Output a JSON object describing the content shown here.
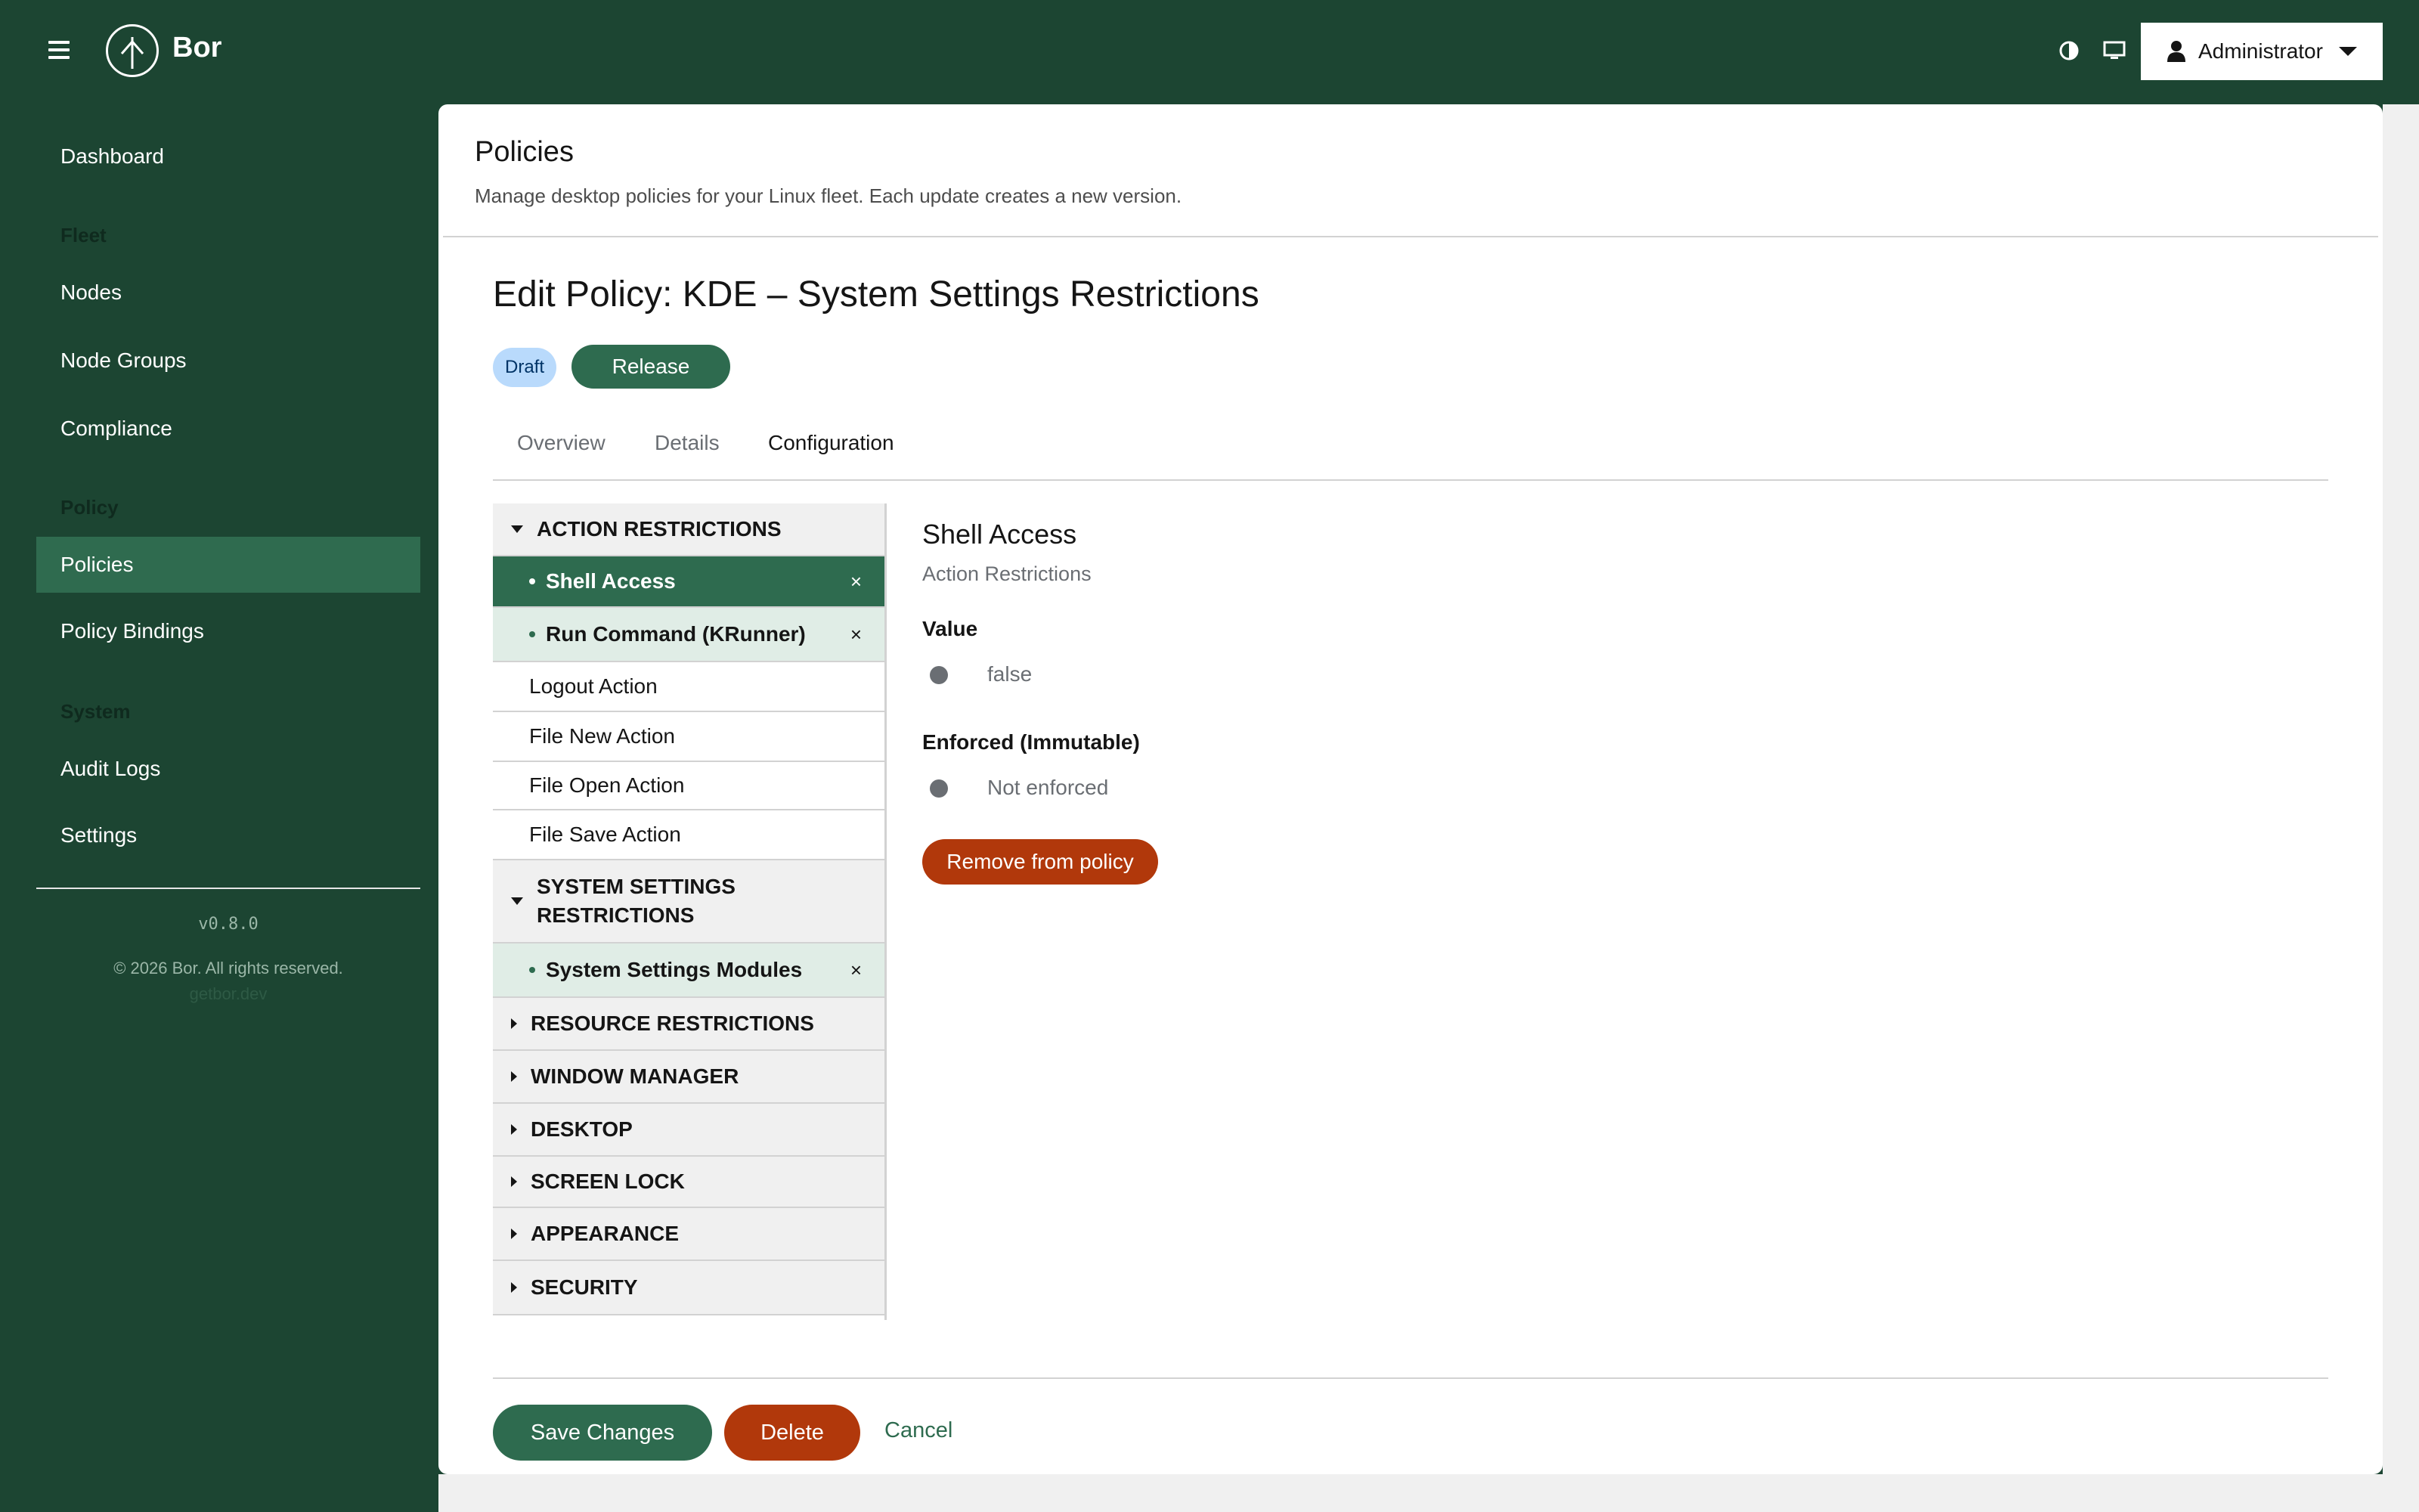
{
  "app": {
    "name": "Bor"
  },
  "header": {
    "user_label": "Administrator"
  },
  "sidebar": {
    "dashboard": "Dashboard",
    "fleet_heading": "Fleet",
    "nodes": "Nodes",
    "node_groups": "Node Groups",
    "compliance": "Compliance",
    "policy_heading": "Policy",
    "policies": "Policies",
    "policy_bindings": "Policy Bindings",
    "system_heading": "System",
    "audit_logs": "Audit Logs",
    "settings": "Settings",
    "version": "v0.8.0",
    "copyright": "© 2026 Bor. All rights reserved.",
    "site": "getbor.dev"
  },
  "page": {
    "title": "Policies",
    "subtitle": "Manage desktop policies for your Linux fleet. Each update creates a new version.",
    "edit_title": "Edit Policy: KDE – System Settings Restrictions",
    "status_badge": "Draft",
    "release_button": "Release"
  },
  "tabs": {
    "overview": "Overview",
    "details": "Details",
    "configuration": "Configuration"
  },
  "tree": {
    "action_restrictions": "ACTION RESTRICTIONS",
    "shell_access": "Shell Access",
    "run_command": "Run Command (KRunner)",
    "logout_action": "Logout Action",
    "file_new_action": "File New Action",
    "file_open_action": "File Open Action",
    "file_save_action": "File Save Action",
    "system_settings_restrictions_1": "SYSTEM SETTINGS",
    "system_settings_restrictions_2": "RESTRICTIONS",
    "system_settings_modules": "System Settings Modules",
    "resource_restrictions": "RESOURCE RESTRICTIONS",
    "window_manager": "WINDOW MANAGER",
    "desktop": "DESKTOP",
    "screen_lock": "SCREEN LOCK",
    "appearance": "APPEARANCE",
    "security": "SECURITY",
    "remove_glyph": "×"
  },
  "detail": {
    "title": "Shell Access",
    "category": "Action Restrictions",
    "value_label": "Value",
    "value": "false",
    "enforced_label": "Enforced (Immutable)",
    "enforced_value": "Not enforced",
    "remove_button": "Remove from policy"
  },
  "footer": {
    "save": "Save Changes",
    "delete": "Delete",
    "cancel": "Cancel"
  },
  "colors": {
    "brand": "#1c4532",
    "primary": "#2e6b4f",
    "danger": "#b1380b",
    "draft_badge": "#b9dafc"
  },
  "icons": [
    "menu-icon",
    "logo-icon",
    "contrast-icon",
    "monitor-icon",
    "user-icon",
    "caret-down-icon"
  ]
}
